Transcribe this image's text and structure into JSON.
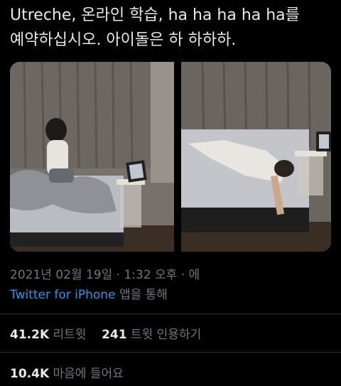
{
  "tweet": {
    "text_line1": "Utreche, 온라인 학습, ha ha ha ha ha를",
    "text_line2": "예약하십시오. 아이돌은 하 하하하.",
    "timestamp": "2021년 02월 19일 · 1:32 오후 · 에",
    "source_link": "Twitter for iPhone",
    "source_suffix": " 앱을 통해"
  },
  "stats": {
    "retweets_count": "41.2K",
    "retweets_label": "리트윗",
    "quotes_count": "241",
    "quotes_label": "트윗 인용하기",
    "likes_count": "10.4K",
    "likes_label": "마음에 들어요"
  }
}
